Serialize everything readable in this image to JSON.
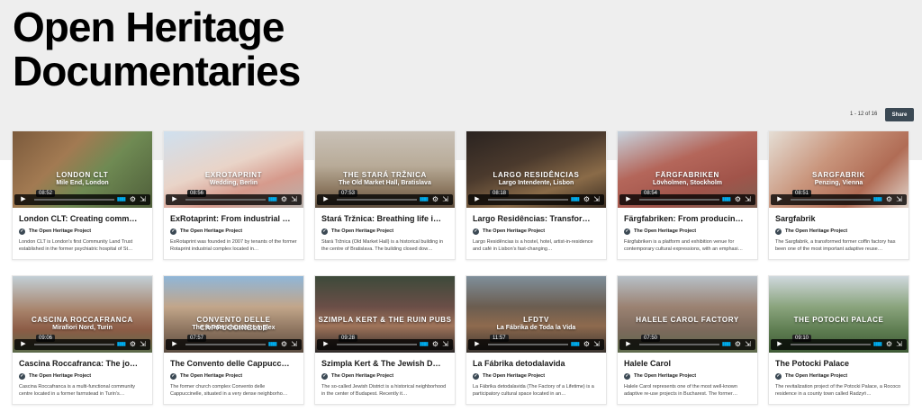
{
  "page": {
    "title_line1": "Open Heritage",
    "title_line2": "Documentaries",
    "pager": "1 - 12 of 16",
    "share_label": "Share"
  },
  "colors": {
    "accent": "#00adef",
    "share_bg": "#3b4954"
  },
  "videos": [
    {
      "overlay_title": "London CLT",
      "overlay_sub": "Mile End, London",
      "duration": "08:52",
      "title": "London CLT: Creating comm…",
      "author": "The Open Heritage Project",
      "desc": "London CLT is London's first Community Land Trust established in the former psychiatric hospital of St…"
    },
    {
      "overlay_title": "EXROTAPRINT",
      "overlay_sub": "Wedding, Berlin",
      "duration": "08:56",
      "title": "ExRotaprint: From industrial …",
      "author": "The Open Heritage Project",
      "desc": "ExRotaprint was founded in 2007 by tenants of the former Rotaprint industrial complex located in…"
    },
    {
      "overlay_title": "THE STARÁ TRŽNICA",
      "overlay_sub": "The Old Market Hall, Bratislava",
      "duration": "07:53",
      "title": "Stará Tržnica: Breathing life i…",
      "author": "The Open Heritage Project",
      "desc": "Stará Tržnica (Old Market Hall) is a historical building in the centre of Bratislava. The building closed dow…"
    },
    {
      "overlay_title": "LARGO RESIDÊNCIAS",
      "overlay_sub": "Largo Intendente, Lisbon",
      "duration": "08:18",
      "title": "Largo Residências: Transfor…",
      "author": "The Open Heritage Project",
      "desc": "Largo Residências is a hostel, hotel, artist-in-residence and café in Lisbon's fast-changing…"
    },
    {
      "overlay_title": "FÄRGFABRIKEN",
      "overlay_sub": "Lövholmen, Stockholm",
      "duration": "08:54",
      "title": "Färgfabriken: From producin…",
      "author": "The Open Heritage Project",
      "desc": "Färgfabriken is a platform and exhibition venue for contemporary cultural expressions, with an emphasi…"
    },
    {
      "overlay_title": "SARGFABRIK",
      "overlay_sub": "Penzing, Vienna",
      "duration": "08:51",
      "title": "Sargfabrik",
      "author": "The Open Heritage Project",
      "desc": "The Sargfabrik, a transformed former coffin factory has been one of the most important adaptive reuse…"
    },
    {
      "overlay_title": "CASCINA ROCCAFRANCA",
      "overlay_sub": "Mirafiori Nord, Turin",
      "duration": "09:06",
      "title": "Cascina Roccafranca: The jo…",
      "author": "The Open Heritage Project",
      "desc": "Cascina Roccafranca is a multi-functional community centre located in a former farmstead in Turin's…"
    },
    {
      "overlay_title": "CONVENTO DELLE CAPPUCCINELLE",
      "overlay_sub": "The former church complex",
      "duration": "07:57",
      "title": "The Convento delle Cappucc…",
      "author": "The Open Heritage Project",
      "desc": "The former church complex Convento delle Cappuccinelle, situated in a very dense neighborho…"
    },
    {
      "overlay_title": "SZIMPLA KERT & THE RUIN PUBS",
      "overlay_sub": "",
      "duration": "09:28",
      "title": "Szimpla Kert & The Jewish D…",
      "author": "The Open Heritage Project",
      "desc": "The so-called Jewish District is a historical neighborhood in the center of Budapest. Recently it…"
    },
    {
      "overlay_title": "LFDTV",
      "overlay_sub": "La Fábrika de Toda la Vida",
      "duration": "11:57",
      "title": "La Fábrika detodalavida",
      "author": "The Open Heritage Project",
      "desc": "La Fábrika detodalavida (The Factory of a Lifetime) is a participatory cultural space located in an…"
    },
    {
      "overlay_title": "HALELE CAROL Factory",
      "overlay_sub": "",
      "duration": "07:50",
      "title": "Halele Carol",
      "author": "The Open Heritage Project",
      "desc": "Halele Carol represents one of the most well-known adaptive re-use projects in Bucharest. The former…"
    },
    {
      "overlay_title": "The Potocki Palace",
      "overlay_sub": "",
      "duration": "09:10",
      "title": "The Potocki Palace",
      "author": "The Open Heritage Project",
      "desc": "The revitalization project of the Potocki Palace, a Rococo residence in a county town called Radzyń…"
    }
  ]
}
